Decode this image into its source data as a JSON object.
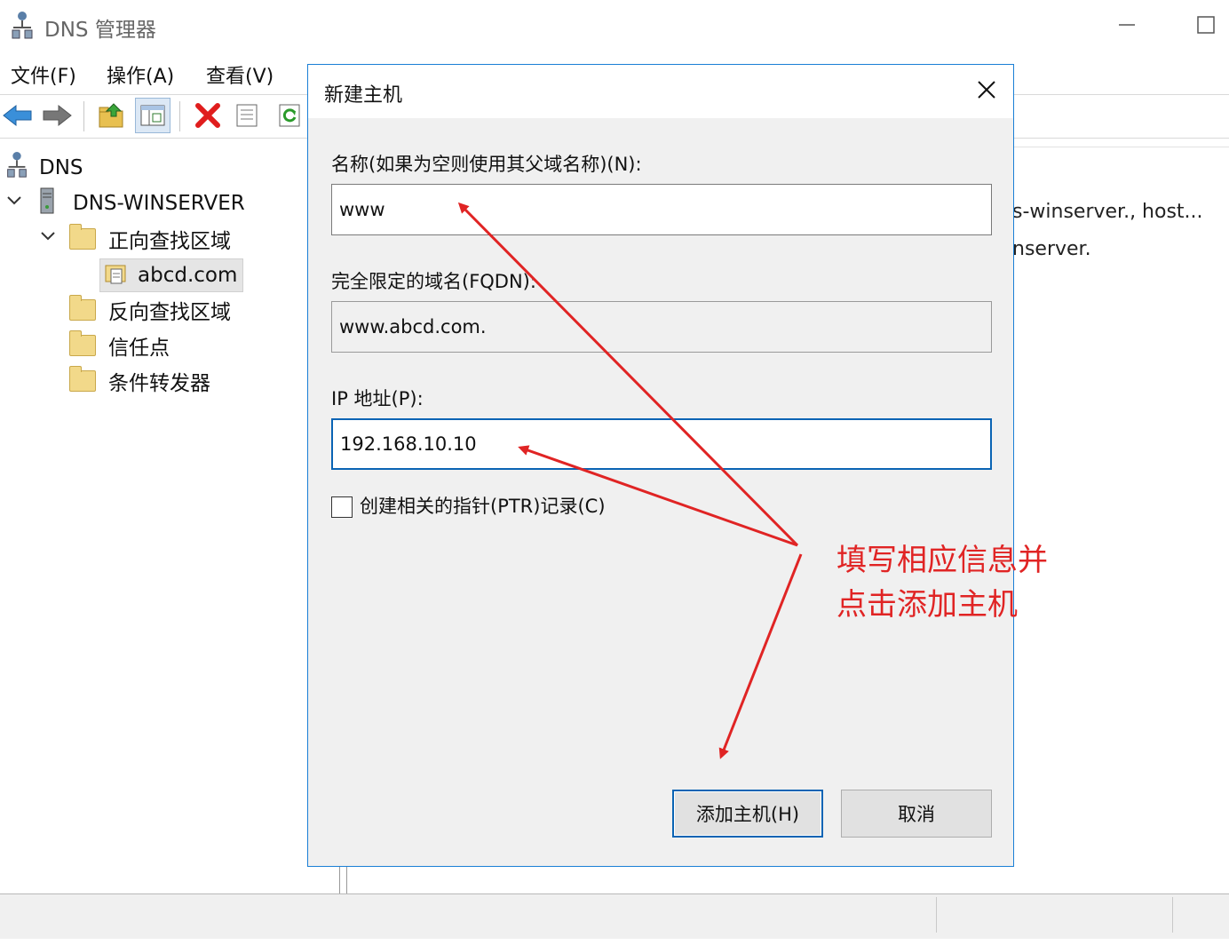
{
  "window": {
    "title": "DNS 管理器"
  },
  "menu": [
    "文件(F)",
    "操作(A)",
    "查看(V)"
  ],
  "toolbar": {
    "icons": [
      "back-arrow-icon",
      "forward-arrow-icon",
      "up-folder-icon",
      "show-hide-tree-icon",
      "delete-icon",
      "properties-icon",
      "refresh-icon"
    ]
  },
  "tree": {
    "root": "DNS",
    "server": "DNS-WINSERVER",
    "forward_zones": "正向查找区域",
    "zone_selected": "abcd.com",
    "reverse_zones": "反向查找区域",
    "trust_points": "信任点",
    "conditional_forwarders": "条件转发器"
  },
  "right_pane": {
    "row1": "s-winserver., host...",
    "row2": "nserver."
  },
  "dialog": {
    "title": "新建主机",
    "name_label": "名称(如果为空则使用其父域名称)(N):",
    "name_value": "www",
    "fqdn_label": "完全限定的域名(FQDN):",
    "fqdn_value": "www.abcd.com.",
    "ip_label": "IP 地址(P):",
    "ip_value": "192.168.10.10",
    "ptr_label": "创建相关的指针(PTR)记录(C)",
    "ptr_checked": false,
    "add_button": "添加主机(H)",
    "cancel_button": "取消"
  },
  "annotation": {
    "line1": "填写相应信息并",
    "line2": "点击添加主机",
    "color": "#e02424"
  },
  "colors": {
    "dialog_border": "#1a7fd6",
    "focus_border": "#0a64b4",
    "annotation_red": "#e02424"
  }
}
